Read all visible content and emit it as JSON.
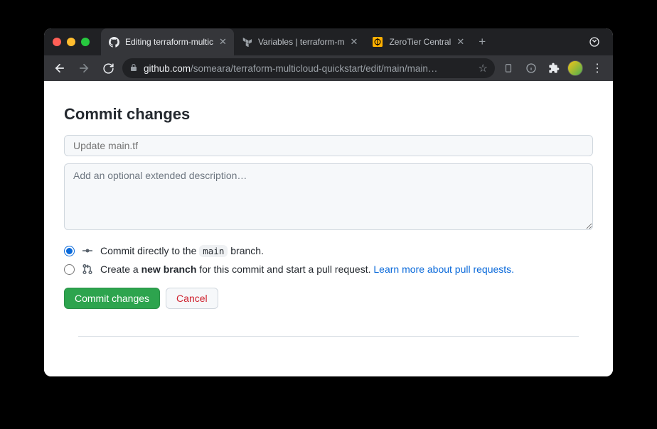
{
  "browser": {
    "tabs": [
      {
        "title": "Editing terraform-multic",
        "active": true
      },
      {
        "title": "Variables | terraform-m",
        "active": false
      },
      {
        "title": "ZeroTier Central",
        "active": false
      }
    ],
    "url_domain": "github.com",
    "url_path": "/someara/terraform-multicloud-quickstart/edit/main/main…"
  },
  "page": {
    "heading": "Commit changes",
    "commit_title_placeholder": "Update main.tf",
    "commit_desc_placeholder": "Add an optional extended description…",
    "radio_direct_prefix": "Commit directly to the ",
    "radio_direct_branch": "main",
    "radio_direct_suffix": " branch.",
    "radio_newbranch_prefix": "Create a ",
    "radio_newbranch_bold": "new branch",
    "radio_newbranch_suffix": " for this commit and start a pull request. ",
    "radio_newbranch_link": "Learn more about pull requests.",
    "commit_btn": "Commit changes",
    "cancel_btn": "Cancel"
  }
}
